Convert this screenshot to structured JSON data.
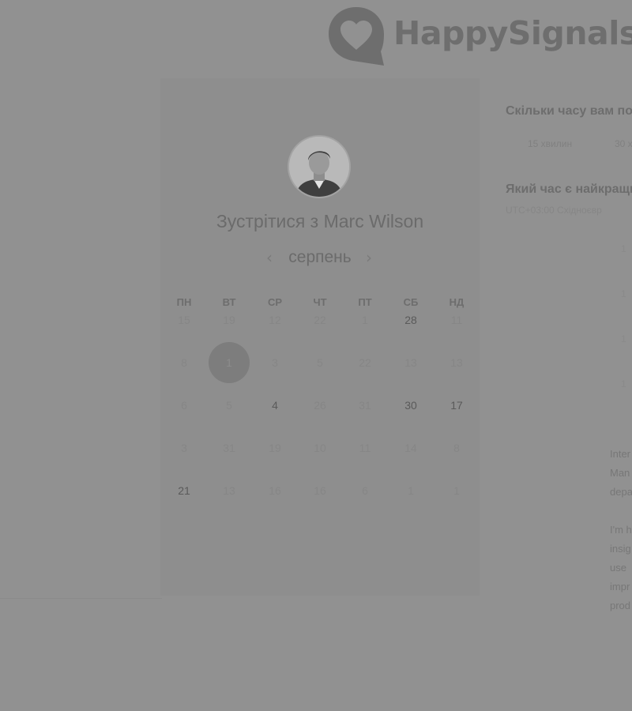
{
  "brand": {
    "name": "HappySignals"
  },
  "booking": {
    "title": "Зустрітися з Marc Wilson",
    "month": "серпень",
    "weekdays": [
      "ПН",
      "ВТ",
      "СР",
      "ЧТ",
      "ПТ",
      "СБ",
      "НД"
    ],
    "weeks": [
      [
        {
          "d": "15"
        },
        {
          "d": "19"
        },
        {
          "d": "12"
        },
        {
          "d": "22"
        },
        {
          "d": "1"
        },
        {
          "d": "28",
          "active": true
        },
        {
          "d": "11"
        }
      ],
      [
        {
          "d": "8"
        },
        {
          "d": "1",
          "selected": true
        },
        {
          "d": "3"
        },
        {
          "d": "5"
        },
        {
          "d": "22"
        },
        {
          "d": "13"
        },
        {
          "d": "13"
        }
      ],
      [
        {
          "d": "6"
        },
        {
          "d": "5"
        },
        {
          "d": "4",
          "active": true
        },
        {
          "d": "26"
        },
        {
          "d": "31"
        },
        {
          "d": "30",
          "active": true
        },
        {
          "d": "17",
          "active": true
        }
      ],
      [
        {
          "d": "3"
        },
        {
          "d": "31"
        },
        {
          "d": "19"
        },
        {
          "d": "10"
        },
        {
          "d": "11"
        },
        {
          "d": "14"
        },
        {
          "d": "8"
        }
      ],
      [
        {
          "d": "21",
          "active": true
        },
        {
          "d": "13"
        },
        {
          "d": "16"
        },
        {
          "d": "16"
        },
        {
          "d": "6"
        },
        {
          "d": "1"
        },
        {
          "d": "1"
        }
      ]
    ]
  },
  "form": {
    "duration_question": "Скільки часу вам по",
    "durations": [
      "15 хвилин",
      "30 х"
    ],
    "time_question": "Який час є найкращий",
    "timezone": "UTC+03:00 Східноєвр",
    "slots": [
      "1",
      "1",
      "1",
      "1"
    ]
  },
  "description": {
    "lines": [
      "Inter",
      "Man",
      "depa",
      "",
      "I'm h",
      "insig",
      "use",
      "impr",
      "prod"
    ]
  }
}
